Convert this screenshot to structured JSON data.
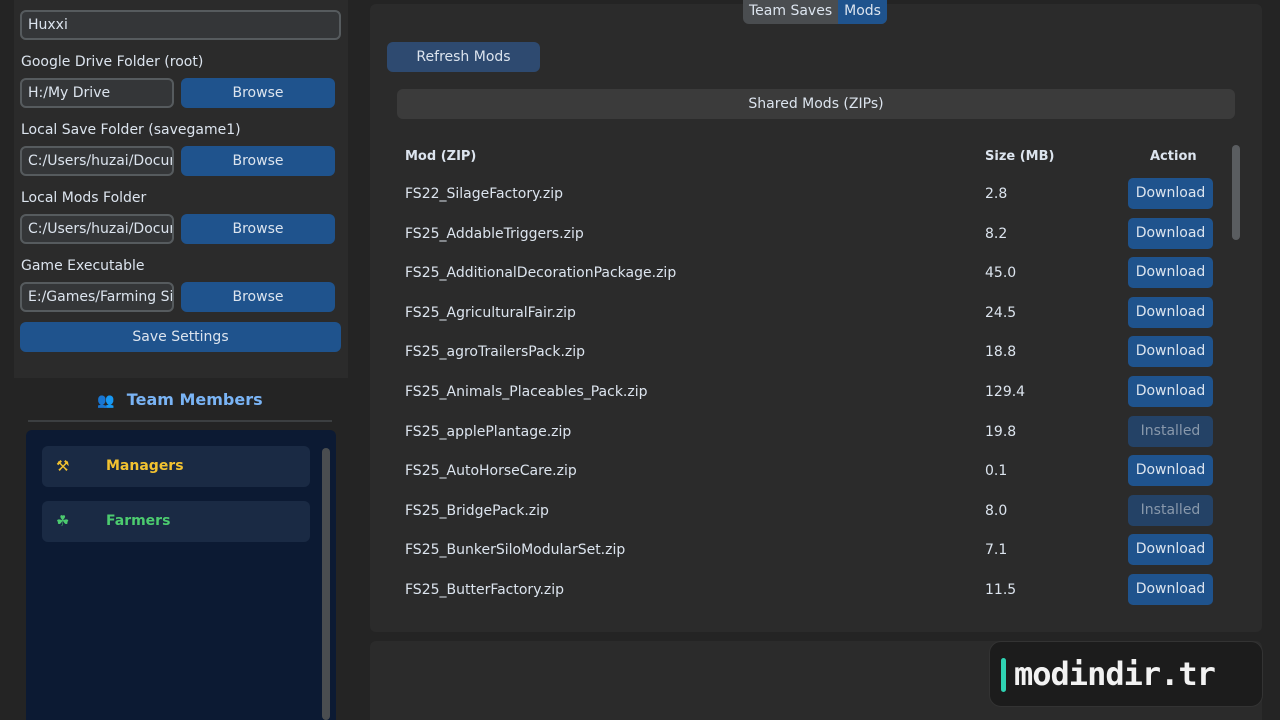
{
  "settings": {
    "username_value": "Huxxi",
    "drive_label": "Google Drive Folder (root)",
    "drive_value": "H:/My Drive",
    "save_label": "Local Save Folder (savegame1)",
    "save_value": "C:/Users/huzai/Docur",
    "mods_label": "Local Mods Folder",
    "mods_value": "C:/Users/huzai/Docur",
    "exe_label": "Game Executable",
    "exe_value": "E:/Games/Farming Si",
    "browse_label": "Browse",
    "save_settings_label": "Save Settings"
  },
  "team": {
    "title": "Team Members",
    "groups": [
      {
        "label": "Managers",
        "color": "#f2c230",
        "icon": "tools-icon"
      },
      {
        "label": "Farmers",
        "color": "#4ccb6f",
        "icon": "farmer-icon"
      }
    ]
  },
  "tabs": {
    "team_saves": "Team Saves",
    "mods": "Mods",
    "active": "Mods"
  },
  "mods": {
    "refresh_label": "Refresh Mods",
    "section_title": "Shared Mods (ZIPs)",
    "columns": [
      "Mod (ZIP)",
      "Size (MB)",
      "Action"
    ],
    "rows": [
      {
        "name": "FS22_SilageFactory.zip",
        "size": "2.8",
        "action": "Download"
      },
      {
        "name": "FS25_AddableTriggers.zip",
        "size": "8.2",
        "action": "Download"
      },
      {
        "name": "FS25_AdditionalDecorationPackage.zip",
        "size": "45.0",
        "action": "Download"
      },
      {
        "name": "FS25_AgriculturalFair.zip",
        "size": "24.5",
        "action": "Download"
      },
      {
        "name": "FS25_agroTrailersPack.zip",
        "size": "18.8",
        "action": "Download"
      },
      {
        "name": "FS25_Animals_Placeables_Pack.zip",
        "size": "129.4",
        "action": "Download"
      },
      {
        "name": "FS25_applePlantage.zip",
        "size": "19.8",
        "action": "Installed"
      },
      {
        "name": "FS25_AutoHorseCare.zip",
        "size": "0.1",
        "action": "Download"
      },
      {
        "name": "FS25_BridgePack.zip",
        "size": "8.0",
        "action": "Installed"
      },
      {
        "name": "FS25_BunkerSiloModularSet.zip",
        "size": "7.1",
        "action": "Download"
      },
      {
        "name": "FS25_ButterFactory.zip",
        "size": "11.5",
        "action": "Download"
      }
    ]
  },
  "watermark": {
    "text": "modindir.tr"
  },
  "colors": {
    "accent": "#1f538d",
    "panel": "#2b2b2b",
    "background": "#242424"
  }
}
